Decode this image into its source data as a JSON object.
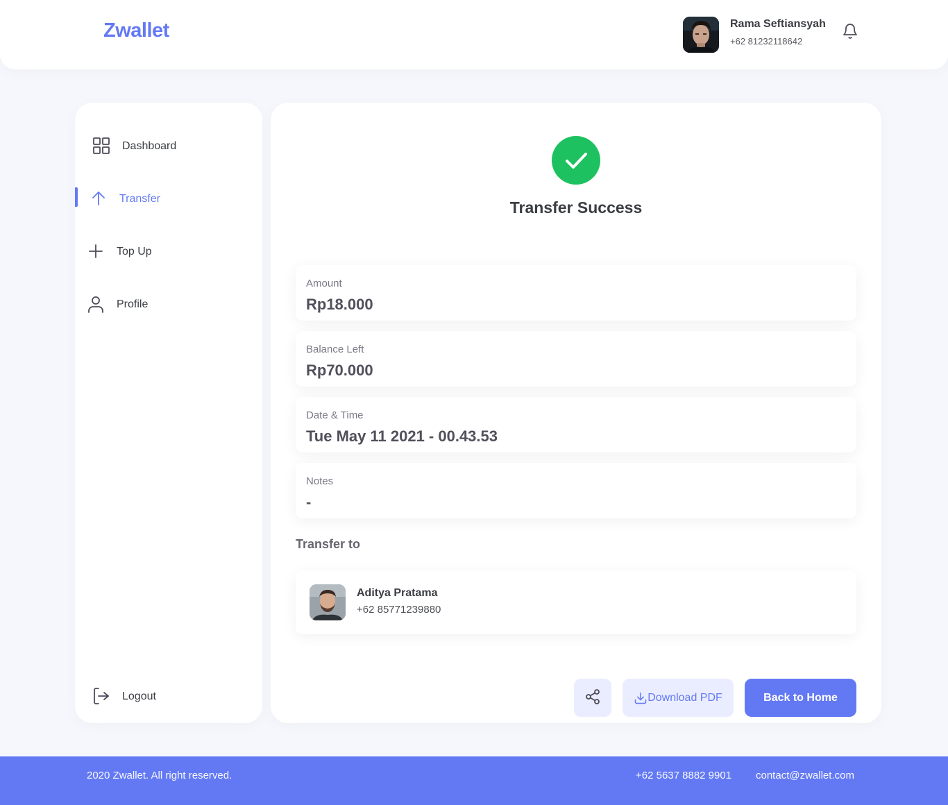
{
  "app": {
    "brand": "Zwallet",
    "accent_color": "#6379F4",
    "success_color": "#1EC15F"
  },
  "header": {
    "user_name": "Rama Seftiansyah",
    "user_phone": "+62 81232118642",
    "notification_icon": "bell-icon"
  },
  "sidebar": {
    "items": [
      {
        "label": "Dashboard",
        "icon": "grid-icon",
        "active": false
      },
      {
        "label": "Transfer",
        "icon": "arrow-up-icon",
        "active": true
      },
      {
        "label": "Top Up",
        "icon": "plus-icon",
        "active": false
      },
      {
        "label": "Profile",
        "icon": "user-icon",
        "active": false
      }
    ],
    "logout": {
      "label": "Logout",
      "icon": "logout-icon"
    }
  },
  "main": {
    "status_title": "Transfer Success",
    "details": [
      {
        "label": "Amount",
        "value": "Rp18.000"
      },
      {
        "label": "Balance Left",
        "value": "Rp70.000"
      },
      {
        "label": "Date & Time",
        "value": "Tue May 11 2021 - 00.43.53"
      },
      {
        "label": "Notes",
        "value": "-"
      }
    ],
    "transfer_to_label": "Transfer to",
    "recipient": {
      "name": "Aditya Pratama",
      "phone": "+62 85771239880"
    },
    "actions": {
      "share_icon": "share-icon",
      "download_label": "Download PDF",
      "home_label": "Back to Home"
    }
  },
  "footer": {
    "copyright": "2020 Zwallet. All right reserved.",
    "phone": "+62 5637 8882 9901",
    "email": "contact@zwallet.com"
  }
}
